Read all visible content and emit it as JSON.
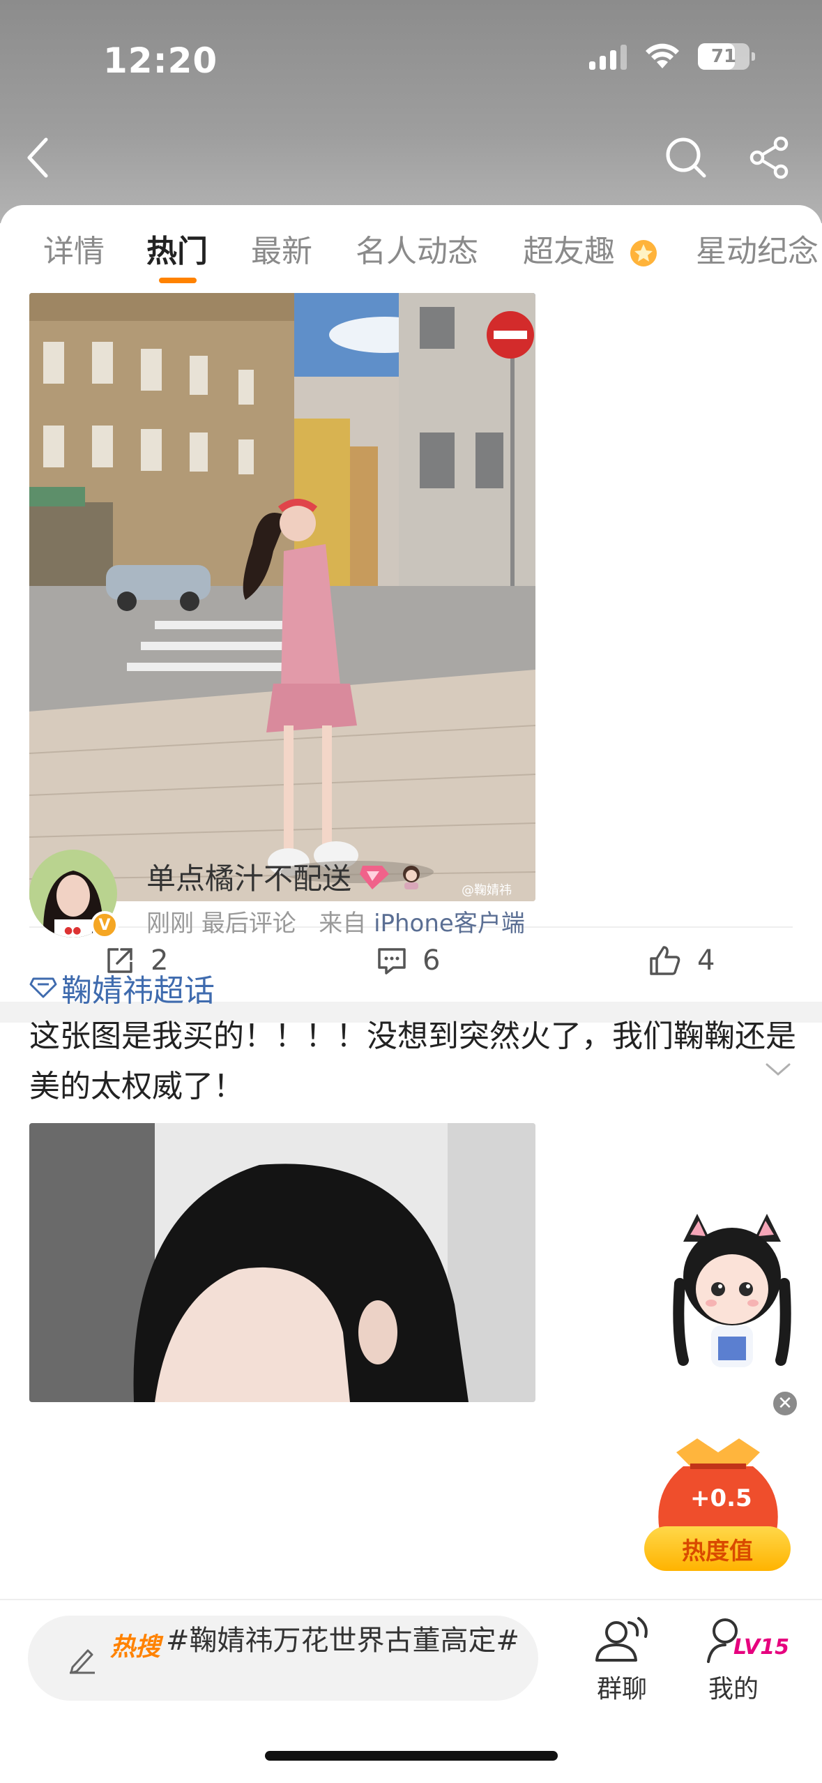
{
  "status_bar": {
    "time": "12:20",
    "battery": "71",
    "battery_level": 0.71
  },
  "header": {
    "back_icon": "chevron-left-icon",
    "search_icon": "search-icon",
    "share_icon": "share-icon"
  },
  "tabs": [
    {
      "label": "详情",
      "active": false
    },
    {
      "label": "热门",
      "active": true
    },
    {
      "label": "最新",
      "active": false
    },
    {
      "label": "名人动态",
      "active": false
    },
    {
      "label": "超友趣",
      "active": false
    },
    {
      "label": "星动纪念",
      "active": false
    }
  ],
  "post1": {
    "watermark": "@鞠婧祎",
    "actions": {
      "repost_count": "2",
      "comment_count": "6",
      "like_count": "4"
    }
  },
  "post2": {
    "username": "单点橘汁不配送",
    "meta_time": "刚刚",
    "meta_last": "最后评论",
    "meta_from": "来自",
    "meta_client": "iPhone客户端",
    "topic": "鞠婧祎超话",
    "text": "这张图是我买的！！！！没想到突然火了，我们鞠鞠还是美的太权威了！"
  },
  "float": {
    "bag_value": "+0.5",
    "heat_label": "热度值"
  },
  "bottom_bar": {
    "hot_tag": "热搜",
    "hot_text": "#鞠婧祎万花世界古董高定#",
    "group_chat": "群聊",
    "mine": "我的",
    "level": "LV15"
  },
  "colors": {
    "accent": "#ff8200",
    "link": "#3f6bae",
    "level": "#e6007e"
  }
}
